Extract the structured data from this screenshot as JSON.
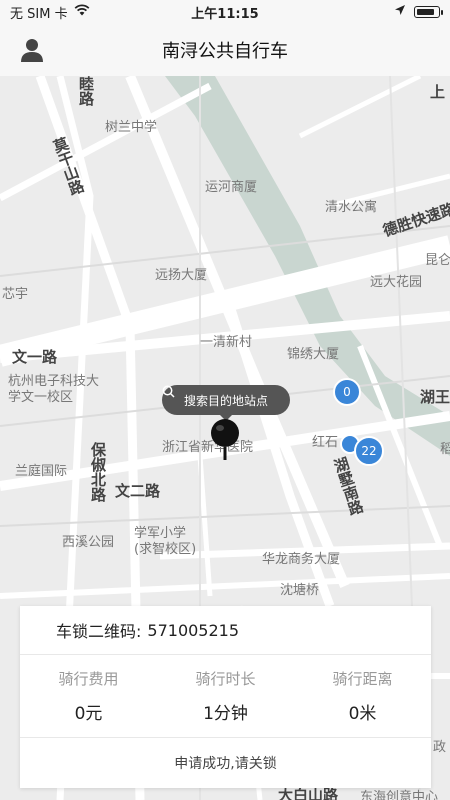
{
  "status_bar": {
    "carrier": "无 SIM 卡",
    "time": "上午11:15",
    "battery_level": 0.85
  },
  "nav": {
    "title": "南浔公共自行车",
    "profile_icon": "user-icon"
  },
  "map": {
    "labels": {
      "l1": "树兰中学",
      "l2": "运河商厦",
      "l3": "清水公寓",
      "l4": "德胜快速路",
      "l5": "远扬大厦",
      "l6": "远大花园",
      "l7": "文一路",
      "l8": "一清新村",
      "l9": "锦绣大厦",
      "l10": "杭州电子科技大学文一校区",
      "l11": "浙江省新华医院",
      "l12": "红石",
      "l13": "湖墅南路",
      "l14": "兰庭国际",
      "l15": "保俶北路",
      "l16": "文二路",
      "l17": "西溪公园",
      "l18": "学军小学(求智校区)",
      "l19": "华龙商务大厦",
      "l20": "沈塘桥",
      "l21": "莫干山路",
      "l22": "睦路",
      "l23": "芯宇",
      "l24": "湖王",
      "l25": "昆仑",
      "l26": "上",
      "l27": "大白山路",
      "l28": "东海创意中心",
      "l29": "政",
      "l30": "稻"
    },
    "search_hint": "搜索目的地站点",
    "clusters": [
      {
        "count": "0"
      },
      {
        "count": "22"
      }
    ]
  },
  "ride_card": {
    "lock_label": "车锁二维码:",
    "lock_code": "571005215",
    "stats": [
      {
        "label": "骑行费用",
        "value": "0元"
      },
      {
        "label": "骑行时长",
        "value": "1分钟"
      },
      {
        "label": "骑行距离",
        "value": "0米"
      }
    ],
    "message": "申请成功,请关锁"
  },
  "colors": {
    "accent": "#3a86d8",
    "bubble": "#555555"
  }
}
